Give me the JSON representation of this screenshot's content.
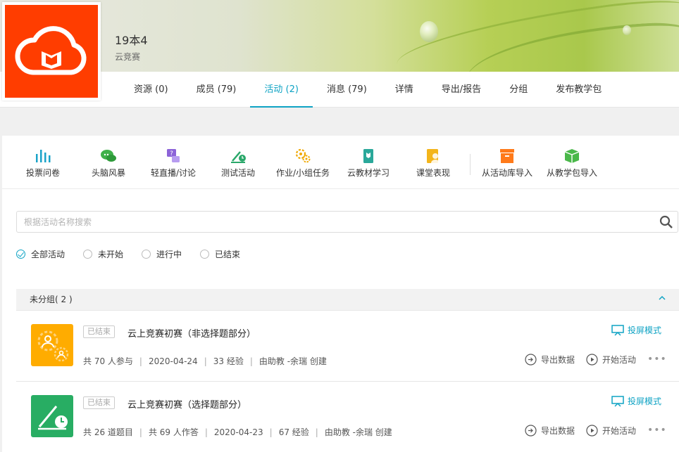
{
  "course": {
    "title": "19本4",
    "subtitle": "云竞赛"
  },
  "tabs": [
    {
      "label": "资源 (0)"
    },
    {
      "label": "成员 (79)"
    },
    {
      "label": "活动 (2)"
    },
    {
      "label": "消息 (79)"
    },
    {
      "label": "详情"
    },
    {
      "label": "导出/报告"
    },
    {
      "label": "分组"
    },
    {
      "label": "发布教学包"
    }
  ],
  "active_tab_index": 2,
  "tools": [
    {
      "label": "投票问卷",
      "icon": "vote-icon",
      "color": "#1aa3c8"
    },
    {
      "label": "头脑风暴",
      "icon": "brainstorm-icon",
      "color": "#3fb14a"
    },
    {
      "label": "轻直播/讨论",
      "icon": "discussion-icon",
      "color": "#8c63d8"
    },
    {
      "label": "测试活动",
      "icon": "test-icon",
      "color": "#2aa86a"
    },
    {
      "label": "作业/小组任务",
      "icon": "homework-icon",
      "color": "#f0a800"
    },
    {
      "label": "云教材学习",
      "icon": "textbook-icon",
      "color": "#2aa89a"
    },
    {
      "label": "课堂表现",
      "icon": "performance-icon",
      "color": "#f3b51b"
    },
    {
      "label": "从活动库导入",
      "icon": "library-import-icon",
      "color": "#ff7a1a"
    },
    {
      "label": "从教学包导入",
      "icon": "package-import-icon",
      "color": "#4ab84a"
    }
  ],
  "search": {
    "placeholder": "根据活动名称搜索"
  },
  "filters": [
    {
      "label": "全部活动",
      "checked": true
    },
    {
      "label": "未开始",
      "checked": false
    },
    {
      "label": "进行中",
      "checked": false
    },
    {
      "label": "已结束",
      "checked": false
    }
  ],
  "group": {
    "label": "未分组( 2 )"
  },
  "activities": [
    {
      "status": "已结束",
      "title": "云上竞赛初赛（非选择题部分）",
      "meta": [
        "共 70 人参与",
        "2020-04-24",
        "33 经验",
        "由助教 -余瑞 创建"
      ],
      "thumb_color": "#ffac00",
      "thumb_icon": "homework-icon",
      "project_label": "投屏模式",
      "export_label": "导出数据",
      "start_label": "开始活动"
    },
    {
      "status": "已结束",
      "title": "云上竞赛初赛（选择题部分）",
      "meta": [
        "共 26 道题目",
        "共 69 人作答",
        "2020-04-23",
        "67 经验",
        "由助教 -余瑞 创建"
      ],
      "thumb_color": "#28ad63",
      "thumb_icon": "test-icon",
      "project_label": "投屏模式",
      "export_label": "导出数据",
      "start_label": "开始活动"
    }
  ],
  "colors": {
    "accent": "#0fa3c4",
    "logo_bg": "#ff3d00"
  }
}
